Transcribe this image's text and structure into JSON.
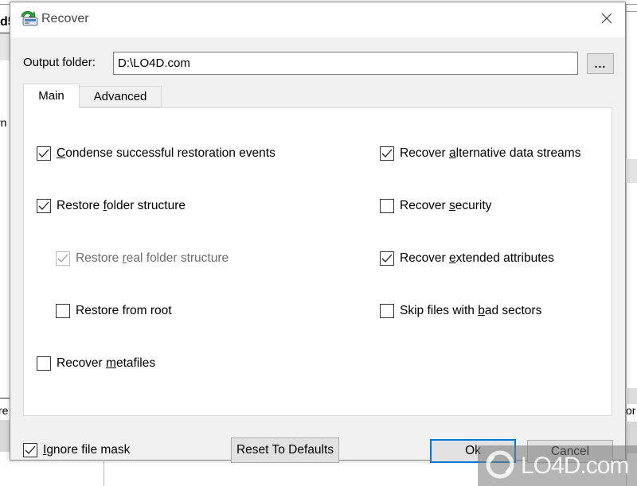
{
  "background": {
    "left_fragment_1": "rn",
    "left_fragment_2": "re",
    "left_header_fragment": "d5",
    "right_fragment": "or"
  },
  "dialog": {
    "title": "Recover",
    "app_icon": "recover-drive-icon",
    "close_icon": "close-icon",
    "output_folder": {
      "label": "Output folder:",
      "value": "D:\\LO4D.com",
      "browse_label": "..."
    },
    "tabs": [
      {
        "label": "Main",
        "active": true
      },
      {
        "label": "Advanced",
        "active": false
      }
    ],
    "main_options": {
      "left": [
        {
          "label": "Condense successful restoration events",
          "mnemonic": "C",
          "checked": true,
          "enabled": true,
          "indented": false
        },
        {
          "label": "Restore folder structure",
          "mnemonic": "f",
          "checked": true,
          "enabled": true,
          "indented": false
        },
        {
          "label": "Restore real folder structure",
          "mnemonic": "r",
          "checked": true,
          "enabled": false,
          "indented": true
        },
        {
          "label": "Restore from root",
          "mnemonic": "",
          "checked": false,
          "enabled": true,
          "indented": true
        },
        {
          "label": "Recover metafiles",
          "mnemonic": "m",
          "checked": false,
          "enabled": true,
          "indented": false
        }
      ],
      "right": [
        {
          "label": "Recover alternative data streams",
          "mnemonic": "a",
          "checked": true,
          "enabled": true
        },
        {
          "label": "Recover security",
          "mnemonic": "s",
          "checked": false,
          "enabled": true
        },
        {
          "label": "Recover extended attributes",
          "mnemonic": "e",
          "checked": true,
          "enabled": true
        },
        {
          "label": "Skip files with bad sectors",
          "mnemonic": "b",
          "checked": false,
          "enabled": true
        }
      ]
    },
    "ignore_file_mask": {
      "label": "Ignore file mask",
      "mnemonic": "I",
      "checked": true
    },
    "buttons": {
      "reset": "Reset To Defaults",
      "ok": "Ok",
      "cancel": "Cancel"
    },
    "accent_color": "#0078d7"
  },
  "watermark": {
    "text": "LO4D.com"
  }
}
